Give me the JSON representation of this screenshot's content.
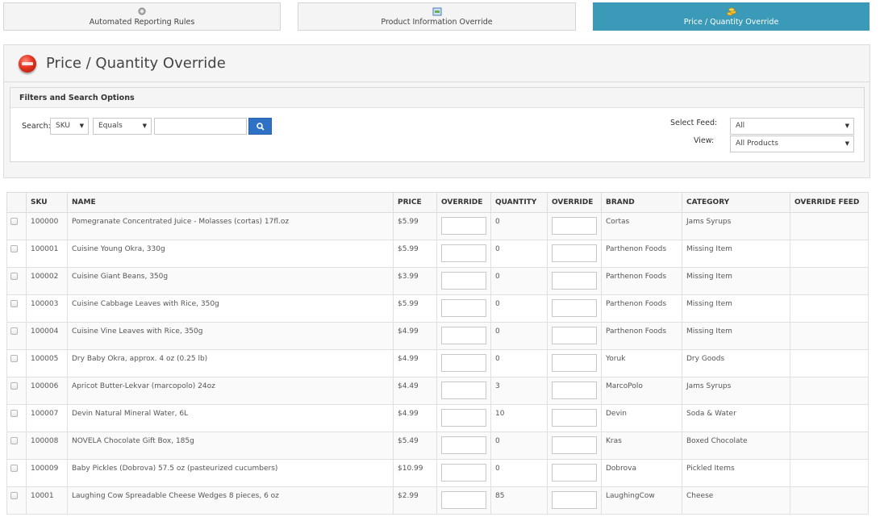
{
  "tabs": [
    {
      "label": "Automated Reporting Rules",
      "icon": "rules-icon",
      "active": false
    },
    {
      "label": "Product Information Override",
      "icon": "product-info-icon",
      "active": false
    },
    {
      "label": "Price / Quantity Override",
      "icon": "price-quantity-icon",
      "active": true
    }
  ],
  "page": {
    "title": "Price / Quantity Override",
    "icon": "stop-button-icon"
  },
  "filters": {
    "heading": "Filters and Search Options",
    "search_label": "Search:",
    "field_select": "SKU",
    "operator_select": "Equals",
    "search_value": "",
    "select_feed_label": "Select Feed:",
    "select_feed_value": "All",
    "view_label": "View:",
    "view_value": "All Products"
  },
  "colors": {
    "accent": "#3a9ab7",
    "search_button": "#2f71c4"
  },
  "table": {
    "headers": [
      "SKU",
      "NAME",
      "PRICE",
      "OVERRIDE",
      "QUANTITY",
      "OVERRIDE",
      "BRAND",
      "CATEGORY",
      "OVERRIDE FEED"
    ],
    "rows": [
      {
        "sku": "100000",
        "name": "Pomegranate Concentrated Juice - Molasses (cortas) 17fl.oz",
        "price": "$5.99",
        "quantity": "0",
        "brand": "Cortas",
        "category": "Jams Syrups",
        "override_feed": ""
      },
      {
        "sku": "100001",
        "name": "Cuisine Young Okra, 330g",
        "price": "$5.99",
        "quantity": "0",
        "brand": "Parthenon Foods",
        "category": "Missing Item",
        "override_feed": ""
      },
      {
        "sku": "100002",
        "name": "Cuisine Giant Beans, 350g",
        "price": "$3.99",
        "quantity": "0",
        "brand": "Parthenon Foods",
        "category": "Missing Item",
        "override_feed": ""
      },
      {
        "sku": "100003",
        "name": "Cuisine Cabbage Leaves with Rice, 350g",
        "price": "$5.99",
        "quantity": "0",
        "brand": "Parthenon Foods",
        "category": "Missing Item",
        "override_feed": ""
      },
      {
        "sku": "100004",
        "name": "Cuisine Vine Leaves with Rice, 350g",
        "price": "$4.99",
        "quantity": "0",
        "brand": "Parthenon Foods",
        "category": "Missing Item",
        "override_feed": ""
      },
      {
        "sku": "100005",
        "name": "Dry Baby Okra, approx. 4 oz (0.25 lb)",
        "price": "$4.99",
        "quantity": "0",
        "brand": "Yoruk",
        "category": "Dry Goods",
        "override_feed": ""
      },
      {
        "sku": "100006",
        "name": "Apricot Butter-Lekvar (marcopolo) 24oz",
        "price": "$4.49",
        "quantity": "3",
        "brand": "MarcoPolo",
        "category": "Jams Syrups",
        "override_feed": ""
      },
      {
        "sku": "100007",
        "name": "Devin Natural Mineral Water, 6L",
        "price": "$4.99",
        "quantity": "10",
        "brand": "Devin",
        "category": "Soda & Water",
        "override_feed": ""
      },
      {
        "sku": "100008",
        "name": "NOVELA Chocolate Gift Box, 185g",
        "price": "$5.49",
        "quantity": "0",
        "brand": "Kras",
        "category": "Boxed Chocolate",
        "override_feed": ""
      },
      {
        "sku": "100009",
        "name": "Baby Pickles (Dobrova) 57.5 oz (pasteurized cucumbers)",
        "price": "$10.99",
        "quantity": "0",
        "brand": "Dobrova",
        "category": "Pickled Items",
        "override_feed": ""
      },
      {
        "sku": "10001",
        "name": "Laughing Cow Spreadable Cheese Wedges 8 pieces, 6 oz",
        "price": "$2.99",
        "quantity": "85",
        "brand": "LaughingCow",
        "category": "Cheese",
        "override_feed": ""
      }
    ]
  }
}
